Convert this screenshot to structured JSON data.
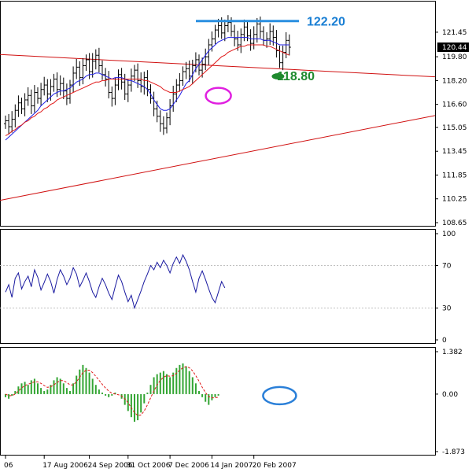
{
  "chart_data": {
    "type": "line",
    "panels": [
      {
        "name": "price",
        "kind": "candlestick",
        "ylim": [
          108.65,
          123.35
        ],
        "yticks": [
          "121.45",
          "119.80",
          "118.20",
          "116.60",
          "115.05",
          "113.45",
          "111.85",
          "110.25",
          "108.65"
        ],
        "yticks_values": [
          121.45,
          119.8,
          118.2,
          116.6,
          115.05,
          113.45,
          111.85,
          110.25,
          108.65
        ],
        "current_price": "120.44",
        "current_value": 120.44,
        "ohlc_x": [
          0,
          1,
          2,
          3,
          4,
          5,
          6,
          7,
          8,
          9,
          10,
          11,
          12,
          13,
          14,
          15,
          16,
          17,
          18,
          19,
          20,
          21,
          22,
          23,
          24,
          25,
          26,
          27,
          28,
          29,
          30,
          31,
          32,
          33,
          34,
          35,
          36,
          37,
          38,
          39,
          40,
          41,
          42,
          43,
          44,
          45,
          46,
          47,
          48,
          49,
          50,
          51,
          52,
          53,
          54,
          55,
          56,
          57,
          58,
          59,
          60,
          61,
          62,
          63,
          64,
          65,
          66,
          67,
          68,
          69,
          70,
          71,
          72,
          73,
          74,
          75,
          76,
          77,
          78,
          79,
          80,
          81,
          82,
          83,
          84,
          85,
          86,
          87,
          88
        ],
        "close": [
          115.5,
          115.1,
          115.6,
          116.2,
          116.7,
          116.3,
          116.9,
          117.2,
          116.5,
          117.4,
          117.0,
          117.6,
          117.9,
          117.3,
          117.8,
          118.3,
          117.6,
          118.0,
          117.5,
          117.0,
          117.9,
          118.7,
          119.1,
          118.4,
          119.2,
          119.6,
          118.8,
          119.5,
          119.9,
          119.2,
          118.6,
          118.3,
          117.4,
          117.0,
          117.9,
          118.6,
          118.1,
          117.3,
          117.9,
          118.5,
          118.9,
          118.2,
          117.8,
          118.4,
          117.6,
          117.0,
          116.3,
          115.8,
          115.3,
          115.0,
          115.7,
          116.5,
          117.3,
          117.9,
          118.2,
          118.8,
          119.0,
          118.5,
          119.2,
          119.6,
          118.9,
          119.3,
          119.8,
          120.6,
          121.0,
          121.6,
          121.9,
          121.4,
          121.9,
          122.1,
          121.5,
          121.0,
          120.6,
          121.3,
          121.8,
          121.2,
          120.7,
          121.3,
          122.0,
          121.5,
          120.9,
          121.0,
          121.5,
          121.1,
          120.2,
          119.4,
          120.1,
          120.9,
          120.44
        ],
        "ma_fast": [
          114.2,
          114.4,
          114.6,
          114.8,
          115.0,
          115.2,
          115.4,
          115.6,
          115.8,
          116.0,
          116.2,
          116.5,
          116.7,
          116.9,
          117.1,
          117.3,
          117.4,
          117.5,
          117.5,
          117.6,
          117.7,
          117.9,
          118.1,
          118.2,
          118.3,
          118.5,
          118.6,
          118.6,
          118.7,
          118.7,
          118.6,
          118.5,
          118.4,
          118.3,
          118.4,
          118.4,
          118.4,
          118.3,
          118.2,
          118.2,
          118.1,
          118.0,
          117.9,
          117.8,
          117.6,
          117.3,
          116.9,
          116.6,
          116.3,
          116.2,
          116.2,
          116.3,
          116.6,
          116.9,
          117.2,
          117.6,
          118.0,
          118.2,
          118.6,
          119.0,
          119.3,
          119.6,
          119.9,
          120.2,
          120.4,
          120.6,
          120.8,
          120.9,
          121.0,
          121.1,
          121.1,
          121.1,
          121.1,
          121.1,
          121.1,
          121.1,
          121.0,
          121.0,
          121.0,
          121.0,
          120.9,
          120.9,
          120.9,
          120.8,
          120.7,
          120.6,
          120.6,
          120.6,
          120.6
        ],
        "ma_slow": [
          114.5,
          114.6,
          114.8,
          114.9,
          115.1,
          115.2,
          115.4,
          115.5,
          115.7,
          115.8,
          116.0,
          116.1,
          116.3,
          116.4,
          116.6,
          116.7,
          116.9,
          117.0,
          117.1,
          117.2,
          117.3,
          117.4,
          117.5,
          117.6,
          117.7,
          117.8,
          117.9,
          118.0,
          118.1,
          118.1,
          118.2,
          118.2,
          118.3,
          118.3,
          118.3,
          118.3,
          118.3,
          118.3,
          118.3,
          118.3,
          118.3,
          118.3,
          118.3,
          118.2,
          118.2,
          118.1,
          118.0,
          117.9,
          117.8,
          117.6,
          117.5,
          117.4,
          117.4,
          117.4,
          117.5,
          117.6,
          117.7,
          117.8,
          118.0,
          118.2,
          118.4,
          118.6,
          118.8,
          119.0,
          119.2,
          119.4,
          119.6,
          119.8,
          119.9,
          120.1,
          120.2,
          120.3,
          120.4,
          120.5,
          120.5,
          120.6,
          120.6,
          120.6,
          120.6,
          120.6,
          120.6,
          120.5,
          120.5,
          120.4,
          120.3,
          120.2,
          120.1,
          120.0,
          119.9
        ]
      },
      {
        "name": "oscillator",
        "kind": "line",
        "ylim": [
          0,
          100
        ],
        "yticks": [
          "100",
          "70",
          "30",
          "0"
        ],
        "yticks_values": [
          100,
          70,
          30,
          0
        ],
        "values": [
          45,
          52,
          40,
          58,
          63,
          48,
          55,
          60,
          50,
          66,
          59,
          47,
          54,
          62,
          55,
          44,
          57,
          66,
          60,
          52,
          58,
          68,
          62,
          50,
          56,
          63,
          55,
          45,
          40,
          50,
          58,
          52,
          44,
          38,
          50,
          61,
          55,
          45,
          36,
          42,
          30,
          38,
          46,
          55,
          62,
          70,
          66,
          73,
          68,
          75,
          70,
          63,
          72,
          78,
          72,
          80,
          74,
          66,
          55,
          45,
          58,
          65,
          57,
          48,
          40,
          35,
          45,
          55,
          49
        ],
        "x_start": 0
      },
      {
        "name": "macd",
        "kind": "histogram",
        "ylim": [
          -1.873,
          1.382
        ],
        "yticks": [
          "1.382",
          "0.00",
          "-1.873"
        ],
        "yticks_values": [
          1.382,
          0.0,
          -1.873
        ],
        "histogram": [
          -0.1,
          -0.15,
          -0.05,
          0.1,
          0.25,
          0.35,
          0.4,
          0.3,
          0.45,
          0.5,
          0.35,
          0.2,
          0.1,
          0.15,
          0.3,
          0.45,
          0.55,
          0.5,
          0.35,
          0.2,
          0.1,
          0.35,
          0.6,
          0.8,
          0.95,
          0.85,
          0.7,
          0.5,
          0.3,
          0.15,
          0.05,
          -0.05,
          -0.1,
          -0.05,
          0.05,
          0.0,
          -0.15,
          -0.35,
          -0.55,
          -0.75,
          -0.9,
          -0.85,
          -0.6,
          -0.3,
          0.05,
          0.3,
          0.55,
          0.65,
          0.7,
          0.75,
          0.65,
          0.55,
          0.7,
          0.85,
          0.95,
          1.0,
          0.9,
          0.75,
          0.55,
          0.35,
          0.1,
          -0.1,
          -0.25,
          -0.35,
          -0.2,
          -0.1,
          -0.05
        ],
        "signal": [
          0.0,
          -0.05,
          -0.05,
          0.0,
          0.1,
          0.2,
          0.28,
          0.32,
          0.36,
          0.4,
          0.4,
          0.35,
          0.28,
          0.22,
          0.24,
          0.3,
          0.38,
          0.44,
          0.44,
          0.38,
          0.3,
          0.3,
          0.4,
          0.55,
          0.7,
          0.78,
          0.78,
          0.7,
          0.58,
          0.45,
          0.32,
          0.2,
          0.1,
          0.03,
          0.0,
          -0.02,
          -0.06,
          -0.15,
          -0.28,
          -0.45,
          -0.6,
          -0.7,
          -0.68,
          -0.55,
          -0.35,
          -0.12,
          0.1,
          0.3,
          0.45,
          0.55,
          0.6,
          0.58,
          0.6,
          0.68,
          0.78,
          0.86,
          0.9,
          0.86,
          0.76,
          0.6,
          0.42,
          0.22,
          0.05,
          -0.08,
          -0.12,
          -0.12,
          -0.1
        ]
      }
    ],
    "xlabels": [
      "06",
      "17 Aug 2006",
      "24 Sep 2006",
      "31 Oct 2006",
      "7 Dec 2006",
      "14 Jan 2007",
      "20 Feb 2007"
    ],
    "xlabels_index": [
      0,
      12,
      26,
      38,
      51,
      64,
      77
    ],
    "annotations": [
      {
        "text": "122.20",
        "color": "#1a7fd4"
      },
      {
        "text": "118.80",
        "color": "#1e8a2e"
      }
    ],
    "grid": false,
    "legend": "none"
  },
  "colors": {
    "candle": "#000000",
    "ma_fast": "#1e1ee6",
    "ma_slow": "#e01818",
    "trendline": "#d01010",
    "oscillator": "#1a1aa0",
    "histogram": "#33a533",
    "signal": "#e01818",
    "circle_magenta": "#e020e0",
    "circle_blue": "#2a7fd8",
    "resistance": "#2a8fe0",
    "support": "#1e8a2e"
  }
}
